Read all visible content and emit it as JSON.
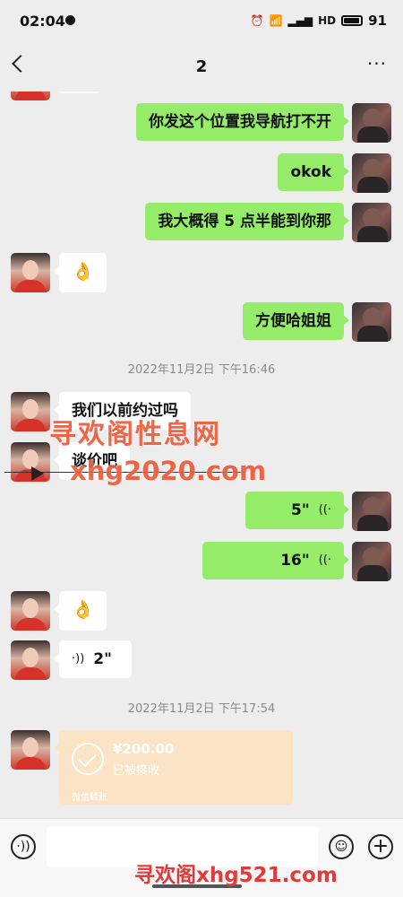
{
  "status_bar": {
    "time": "02:04",
    "network": "HD",
    "battery": "91"
  },
  "header": {
    "back_icon": "chevron-left-icon",
    "title": "2",
    "more_icon": "ellipsis-icon"
  },
  "messages": [
    {
      "from": "me",
      "type": "text",
      "text": "你发这个位置我导航打不开"
    },
    {
      "from": "me",
      "type": "text",
      "text": "okok"
    },
    {
      "from": "me",
      "type": "text",
      "text": "我大概得 5 点半能到你那"
    },
    {
      "from": "them",
      "type": "emoji",
      "text": "👌"
    },
    {
      "from": "me",
      "type": "text",
      "text": "方便哈姐姐"
    },
    {
      "type": "timestamp",
      "text": "2022年11月2日 下午16:46"
    },
    {
      "from": "them",
      "type": "text",
      "text": "我们以前约过吗"
    },
    {
      "from": "them",
      "type": "text",
      "text": "谈价吧"
    },
    {
      "from": "me",
      "type": "voice",
      "duration": "5\""
    },
    {
      "from": "me",
      "type": "voice",
      "duration": "16\""
    },
    {
      "from": "them",
      "type": "emoji",
      "text": "👌"
    },
    {
      "from": "them",
      "type": "voice",
      "duration": "2\""
    },
    {
      "type": "timestamp",
      "text": "2022年11月2日 下午17:54"
    },
    {
      "from": "them",
      "type": "transfer",
      "amount": "¥200.00",
      "status": "已被接收",
      "footer": "微信转账"
    }
  ],
  "watermarks": {
    "site_name": "寻欢阁性息网",
    "site_url": "xhg2020.com",
    "bottom_banner": "寻欢阁xhg521.com"
  },
  "input_bar": {
    "voice_icon": "voice-toggle-icon",
    "emoji_icon": "smiley-icon",
    "plus_icon": "plus-icon"
  },
  "colors": {
    "my_bubble": "#95ec69",
    "their_bubble": "#ffffff",
    "background": "#ededed",
    "transfer_card": "#fbe4c5",
    "watermark": "#ee5a3a"
  }
}
